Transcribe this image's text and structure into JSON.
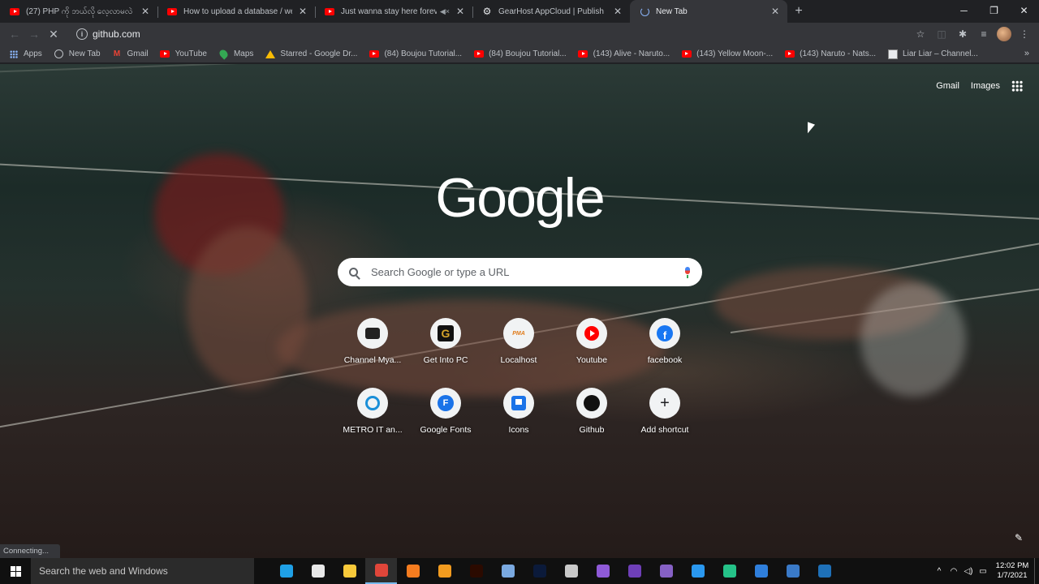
{
  "tabs": [
    {
      "title": "(27) PHP ကို ဘယ်လို လေ့လာမလဲ",
      "favicon": "youtube-icon",
      "active": false,
      "muted": false
    },
    {
      "title": "How to upload a database / web",
      "favicon": "youtube-icon",
      "active": false,
      "muted": false
    },
    {
      "title": "Just wanna stay here forever",
      "favicon": "youtube-icon",
      "active": false,
      "muted": true
    },
    {
      "title": "GearHost AppCloud | Publish",
      "favicon": "gear-icon",
      "active": false,
      "muted": false
    },
    {
      "title": "New Tab",
      "favicon": "loading-spinner",
      "active": true,
      "muted": false
    }
  ],
  "toolbar": {
    "url": "github.com"
  },
  "bookmarks": [
    {
      "label": "Apps",
      "icon": "apps-grid-icon"
    },
    {
      "label": "New Tab",
      "icon": "globe-icon"
    },
    {
      "label": "Gmail",
      "icon": "gmail-icon"
    },
    {
      "label": "YouTube",
      "icon": "youtube-icon"
    },
    {
      "label": "Maps",
      "icon": "maps-icon"
    },
    {
      "label": "Starred - Google Dr...",
      "icon": "drive-icon"
    },
    {
      "label": "(84) Boujou Tutorial...",
      "icon": "youtube-icon"
    },
    {
      "label": "(84) Boujou Tutorial...",
      "icon": "youtube-icon"
    },
    {
      "label": "(143) Alive - Naruto...",
      "icon": "youtube-icon"
    },
    {
      "label": "(143) Yellow Moon-...",
      "icon": "youtube-icon"
    },
    {
      "label": "(143) Naruto - Nats...",
      "icon": "youtube-icon"
    },
    {
      "label": "Liar Liar – Channel...",
      "icon": "liar-icon"
    }
  ],
  "ntp": {
    "gmail": "Gmail",
    "images": "Images",
    "logo": "Google",
    "search_placeholder": "Search Google or type a URL",
    "shortcuts": [
      {
        "label": "Channel Mya...",
        "icon": "camera-icon"
      },
      {
        "label": "Get Into PC",
        "icon": "getintopc-icon"
      },
      {
        "label": "Localhost",
        "icon": "pma-icon"
      },
      {
        "label": "Youtube",
        "icon": "youtube-icon"
      },
      {
        "label": "facebook",
        "icon": "facebook-icon"
      },
      {
        "label": "METRO IT an...",
        "icon": "ring-icon"
      },
      {
        "label": "Google Fonts",
        "icon": "google-fonts-icon"
      },
      {
        "label": "Icons",
        "icon": "flag-icon"
      },
      {
        "label": "Github",
        "icon": "github-icon"
      },
      {
        "label": "Add shortcut",
        "icon": "plus-icon"
      }
    ]
  },
  "status": "Connecting...",
  "taskbar": {
    "search_placeholder": "Search the web and Windows",
    "time": "12:02 PM",
    "date": "1/7/2021",
    "apps": [
      {
        "name": "edge",
        "color": "#1fa0e6",
        "open": false
      },
      {
        "name": "store",
        "color": "#e8e8e8",
        "open": false
      },
      {
        "name": "file-explorer",
        "color": "#f8c93a",
        "open": false
      },
      {
        "name": "chrome",
        "color": "#e0463a",
        "open": true
      },
      {
        "name": "xampp",
        "color": "#f57c1f",
        "open": false
      },
      {
        "name": "sublime",
        "color": "#f29b1f",
        "open": false
      },
      {
        "name": "illustrator",
        "color": "#2b0a00",
        "open": false
      },
      {
        "name": "virtualbox",
        "color": "#7aa9e0",
        "open": false
      },
      {
        "name": "photoshop",
        "color": "#0b1a3a",
        "open": false
      },
      {
        "name": "gimp-like",
        "color": "#c9c9c9",
        "open": false
      },
      {
        "name": "git",
        "color": "#8f5ad8",
        "open": false
      },
      {
        "name": "app-purple",
        "color": "#6f3fb8",
        "open": false
      },
      {
        "name": "visual-studio",
        "color": "#8661c5",
        "open": false
      },
      {
        "name": "vscode",
        "color": "#2a98ef",
        "open": false
      },
      {
        "name": "app-green",
        "color": "#25c288",
        "open": false
      },
      {
        "name": "app-blue",
        "color": "#2f7fdc",
        "open": false
      },
      {
        "name": "app-window",
        "color": "#3a7ac8",
        "open": false
      },
      {
        "name": "app-ide",
        "color": "#1e70b8",
        "open": false
      }
    ]
  }
}
